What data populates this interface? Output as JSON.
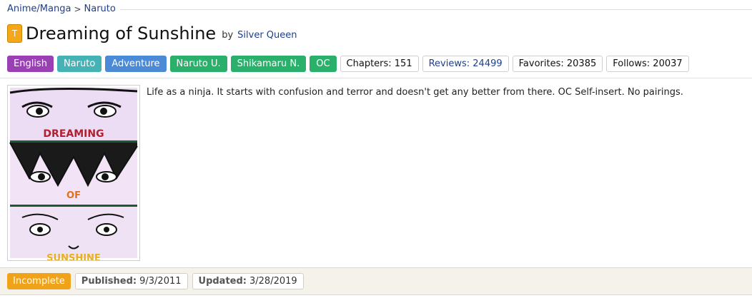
{
  "breadcrumb": {
    "category": "Anime/Manga",
    "separator": ">",
    "fandom": "Naruto"
  },
  "story": {
    "rating_letter": "T",
    "title": "Dreaming of Sunshine",
    "by_label": "by",
    "author": "Silver Queen",
    "summary": "Life as a ninja. It starts with confusion and terror and doesn't get any better from there. OC Self-insert. No pairings."
  },
  "tags": {
    "language": "English",
    "fandom": "Naruto",
    "genre": "Adventure",
    "characters": [
      "Naruto U.",
      "Shikamaru N.",
      "OC"
    ]
  },
  "stats": {
    "chapters": "Chapters: 151",
    "reviews": "Reviews: 24499",
    "favorites": "Favorites: 20385",
    "follows": "Follows: 20037"
  },
  "cover": {
    "words": [
      "DREAMING",
      "OF",
      "SUNSHINE"
    ]
  },
  "footer": {
    "status": "Incomplete",
    "published_label": "Published:",
    "published": "9/3/2011",
    "updated_label": "Updated:",
    "updated": "3/28/2019"
  },
  "colors": {
    "accent_link": "#1d3f8f",
    "language_tag": "#9b3fb5",
    "fandom_tag": "#45b2b6",
    "genre_tag": "#4a8ad6",
    "character_tag": "#2ab06b",
    "status_incomplete": "#f0a218"
  }
}
